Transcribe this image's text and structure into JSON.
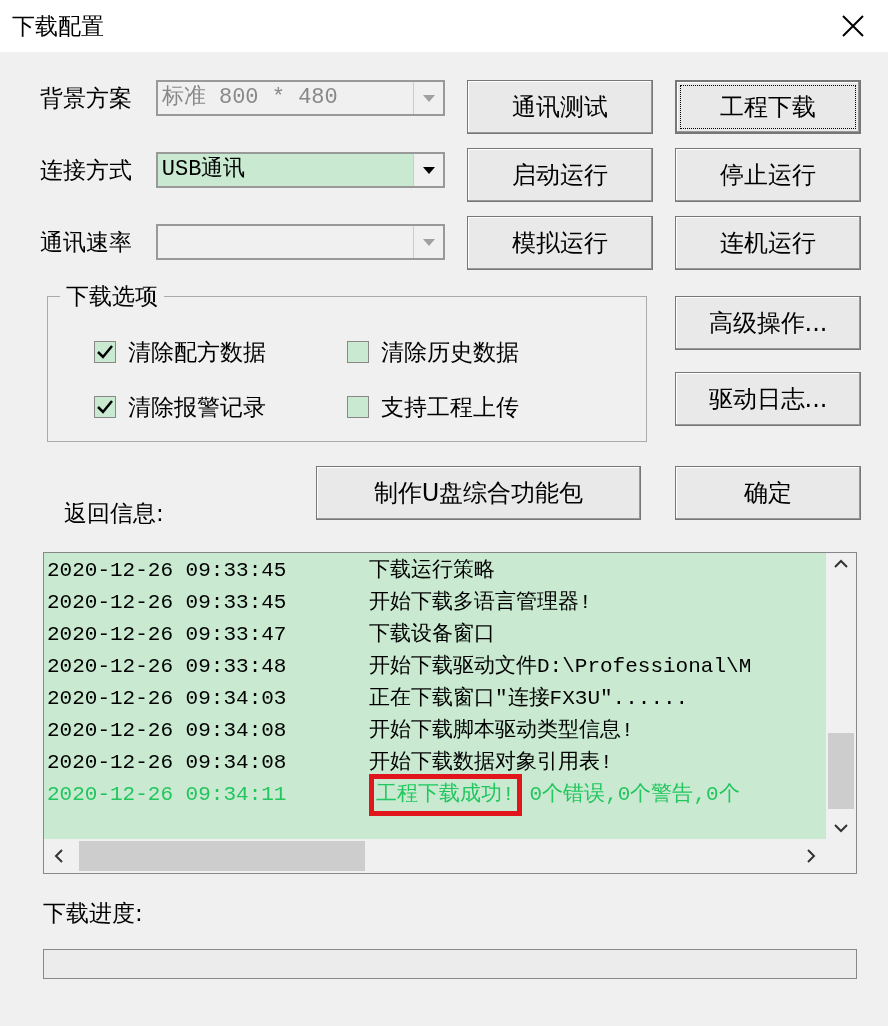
{
  "window": {
    "title": "下载配置"
  },
  "fields": [
    {
      "label": "背景方案",
      "value": "标准 800 * 480",
      "disabled": true
    },
    {
      "label": "连接方式",
      "value": "USB通讯",
      "disabled": false
    },
    {
      "label": "通讯速率",
      "disabled": true
    }
  ],
  "buttons": [
    {
      "label": "通讯测试",
      "default": false
    },
    {
      "label": "工程下载",
      "default": true
    },
    {
      "label": "启动运行",
      "default": false
    },
    {
      "label": "停止运行",
      "default": false
    },
    {
      "label": "模拟运行",
      "default": false
    },
    {
      "label": "连机运行",
      "default": false
    }
  ],
  "download_options": {
    "title": "下载选项",
    "items": [
      {
        "label": "清除配方数据",
        "checked": true
      },
      {
        "label": "清除历史数据",
        "checked": false
      },
      {
        "label": "清除报警记录",
        "checked": true
      },
      {
        "label": "支持工程上传",
        "checked": false
      }
    ]
  },
  "side_buttons": [
    "高级操作...",
    "驱动日志..."
  ],
  "package_button": "制作U盘综合功能包",
  "ok_button": "确定",
  "log": {
    "label": "返回信息:",
    "rows": [
      {
        "time": "2020-12-26 09:33:45",
        "message": "下载运行策略",
        "kind": "normal",
        "highlighted": false
      },
      {
        "time": "2020-12-26 09:33:45",
        "message": "开始下载多语言管理器!",
        "kind": "normal",
        "highlighted": false
      },
      {
        "time": "2020-12-26 09:33:47",
        "message": "下载设备窗口",
        "kind": "normal",
        "highlighted": false
      },
      {
        "time": "2020-12-26 09:33:48",
        "message": "开始下载驱动文件D:\\Professional\\M",
        "kind": "normal",
        "highlighted": false
      },
      {
        "time": "2020-12-26 09:34:03",
        "message": "正在下载窗口\"连接FX3U\"......",
        "kind": "normal",
        "highlighted": false
      },
      {
        "time": "2020-12-26 09:34:08",
        "message": "开始下载脚本驱动类型信息!",
        "kind": "normal",
        "highlighted": false
      },
      {
        "time": "2020-12-26 09:34:08",
        "message": "开始下载数据对象引用表!",
        "kind": "normal",
        "highlighted": false
      },
      {
        "time": "2020-12-26 09:34:11",
        "message": "工程下载成功!",
        "detail": "0个错误,0个警告,0个",
        "kind": "success",
        "highlighted": true
      }
    ]
  },
  "progress": {
    "label": "下载进度:",
    "level": 0
  }
}
